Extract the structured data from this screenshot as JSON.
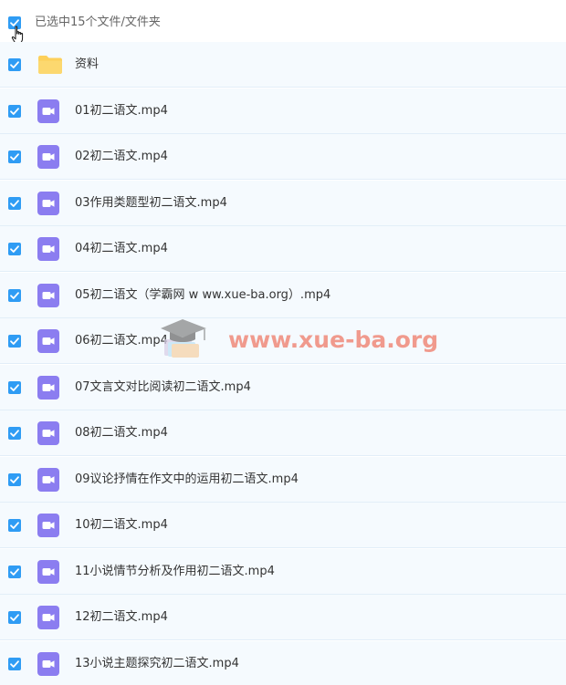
{
  "header": {
    "selection_text": "已选中15个文件/文件夹"
  },
  "rows": [
    {
      "name": "资料",
      "type": "folder"
    },
    {
      "name": "01初二语文.mp4",
      "type": "video"
    },
    {
      "name": "02初二语文.mp4",
      "type": "video"
    },
    {
      "name": "03作用类题型初二语文.mp4",
      "type": "video"
    },
    {
      "name": "04初二语文.mp4",
      "type": "video"
    },
    {
      "name": "05初二语文（学霸网 w ww.xue-ba.org）.mp4",
      "type": "video"
    },
    {
      "name": "06初二语文.mp4",
      "type": "video"
    },
    {
      "name": "07文言文对比阅读初二语文.mp4",
      "type": "video"
    },
    {
      "name": "08初二语文.mp4",
      "type": "video"
    },
    {
      "name": "09议论抒情在作文中的运用初二语文.mp4",
      "type": "video"
    },
    {
      "name": "10初二语文.mp4",
      "type": "video"
    },
    {
      "name": "11小说情节分析及作用初二语文.mp4",
      "type": "video"
    },
    {
      "name": "12初二语文.mp4",
      "type": "video"
    },
    {
      "name": "13小说主题探究初二语文.mp4",
      "type": "video"
    }
  ],
  "watermark": {
    "text": "www.xue-ba.org"
  },
  "colors": {
    "checkbox": "#2f9cf4",
    "video_icon": "#8b7df0",
    "folder_icon": "#fdd05a",
    "row_background": "#f5fafe",
    "watermark_text": "#f08a7a"
  }
}
